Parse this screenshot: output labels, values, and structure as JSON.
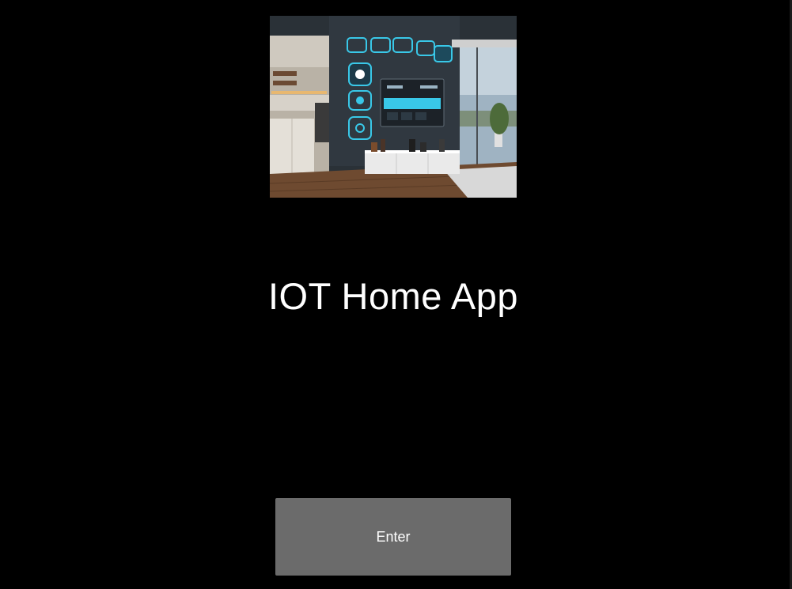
{
  "app": {
    "title": "IOT Home App"
  },
  "hero_image": {
    "alt": "smart home interior"
  },
  "actions": {
    "enter_label": "Enter"
  },
  "colors": {
    "background": "#000000",
    "title_text": "#ffffff",
    "button_background": "#6b6b6b",
    "button_text": "#ffffff",
    "ui_accent": "#39c8e8"
  }
}
